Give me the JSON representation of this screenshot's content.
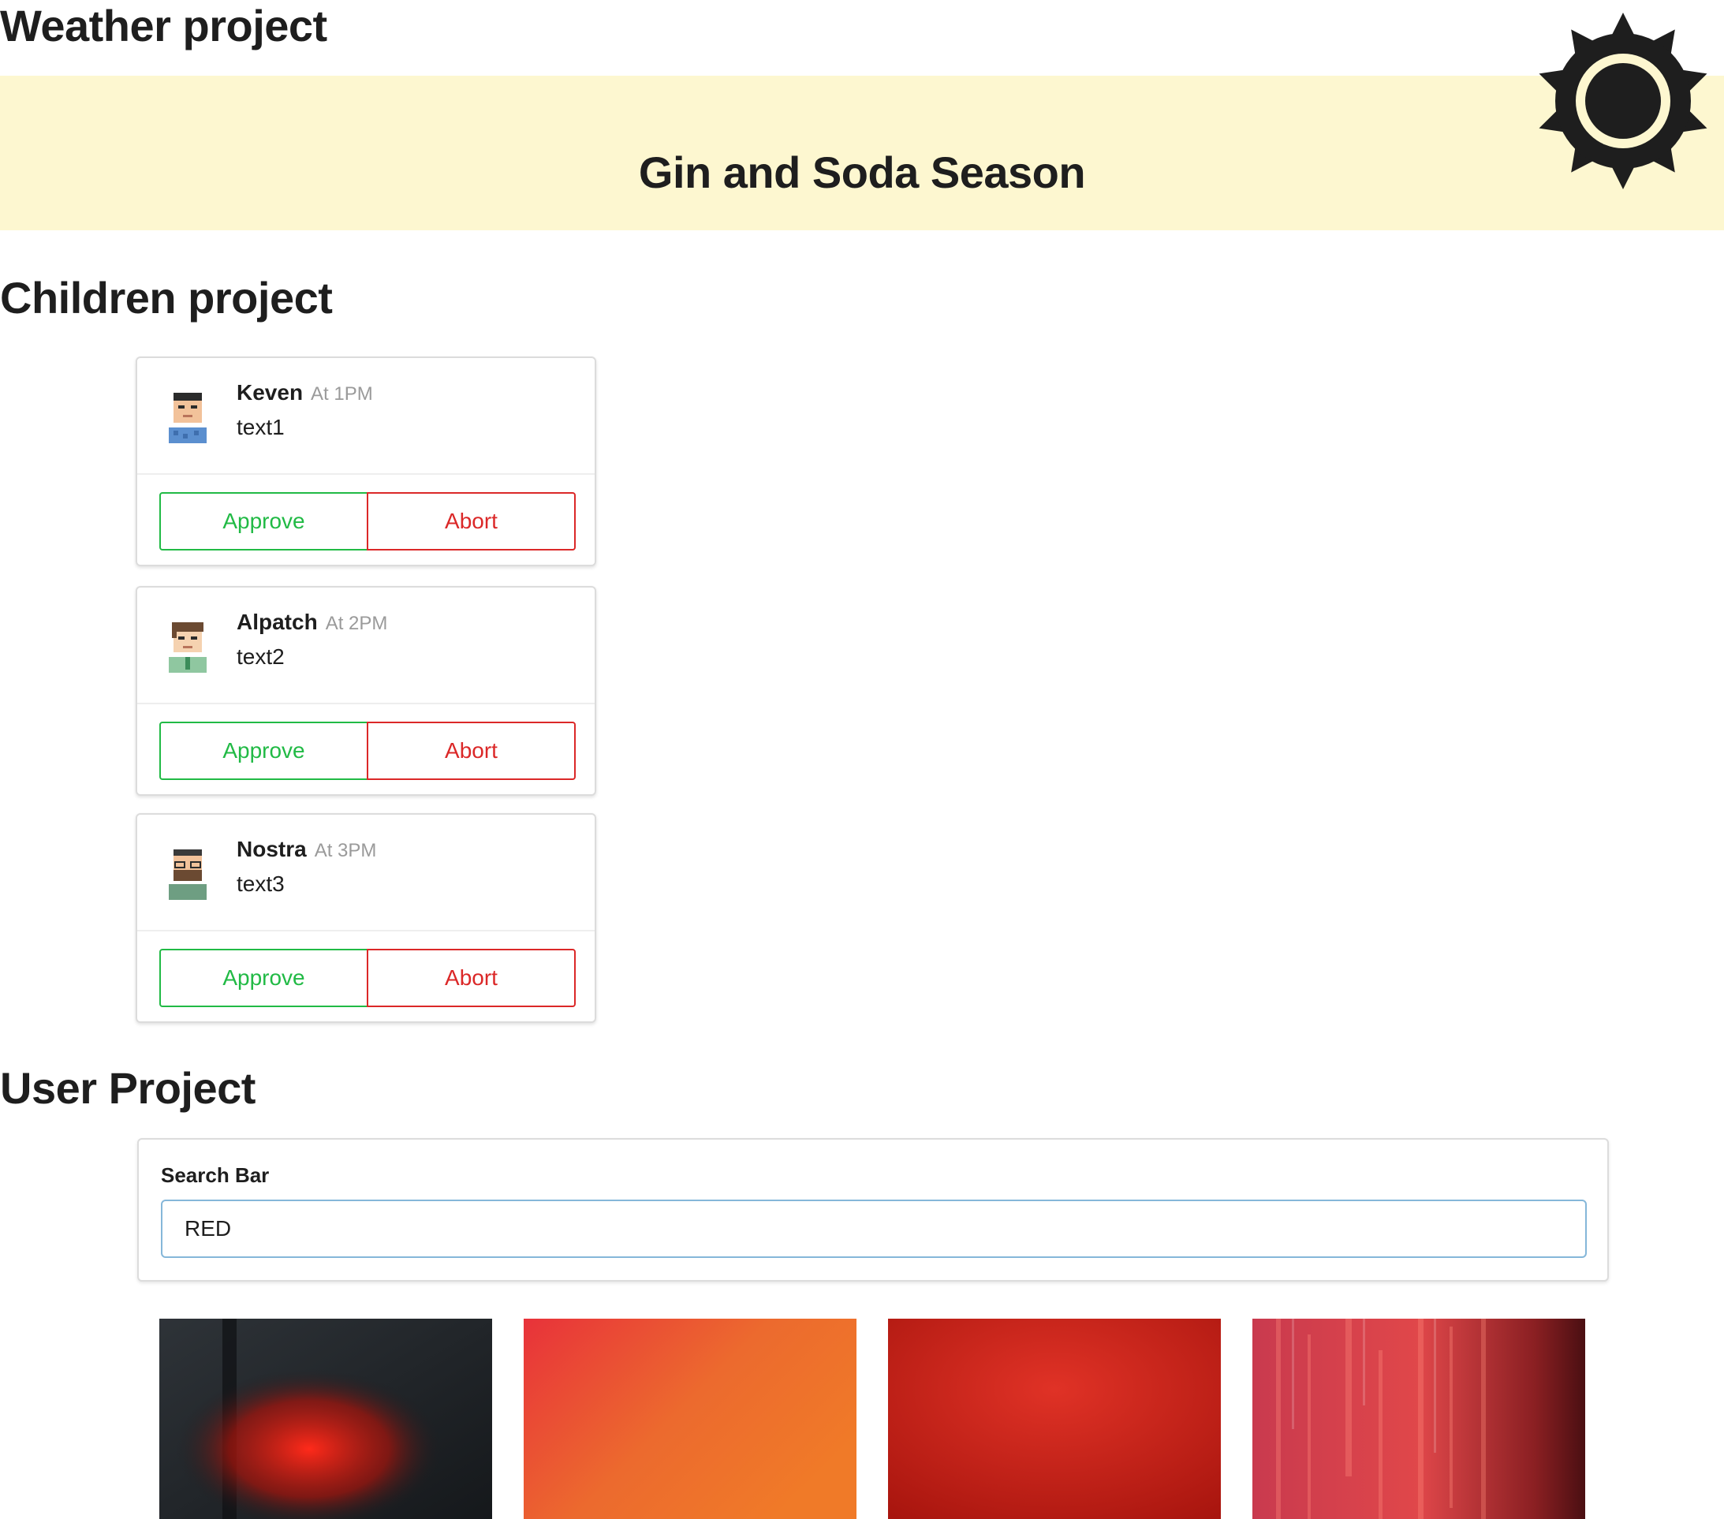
{
  "weather": {
    "title": "Weather project",
    "headline": "Gin and Soda Season",
    "icon": "sun-icon",
    "banner_color": "#fdf7d0"
  },
  "children": {
    "title": "Children project",
    "comments": [
      {
        "author": "Keven",
        "time": "At 1PM",
        "text": "text1",
        "approve": "Approve",
        "abort": "Abort"
      },
      {
        "author": "Alpatch",
        "time": "At 2PM",
        "text": "text2",
        "approve": "Approve",
        "abort": "Abort"
      },
      {
        "author": "Nostra",
        "time": "At 3PM",
        "text": "text3",
        "approve": "Approve",
        "abort": "Abort"
      }
    ],
    "colors": {
      "approve": "#21ba45",
      "abort": "#db2828"
    }
  },
  "user": {
    "title": "User Project",
    "search": {
      "label": "Search Bar",
      "value": "RED"
    },
    "images": [
      "red-lights-image",
      "red-orange-gradient-image",
      "red-texture-image",
      "red-paint-image"
    ]
  }
}
